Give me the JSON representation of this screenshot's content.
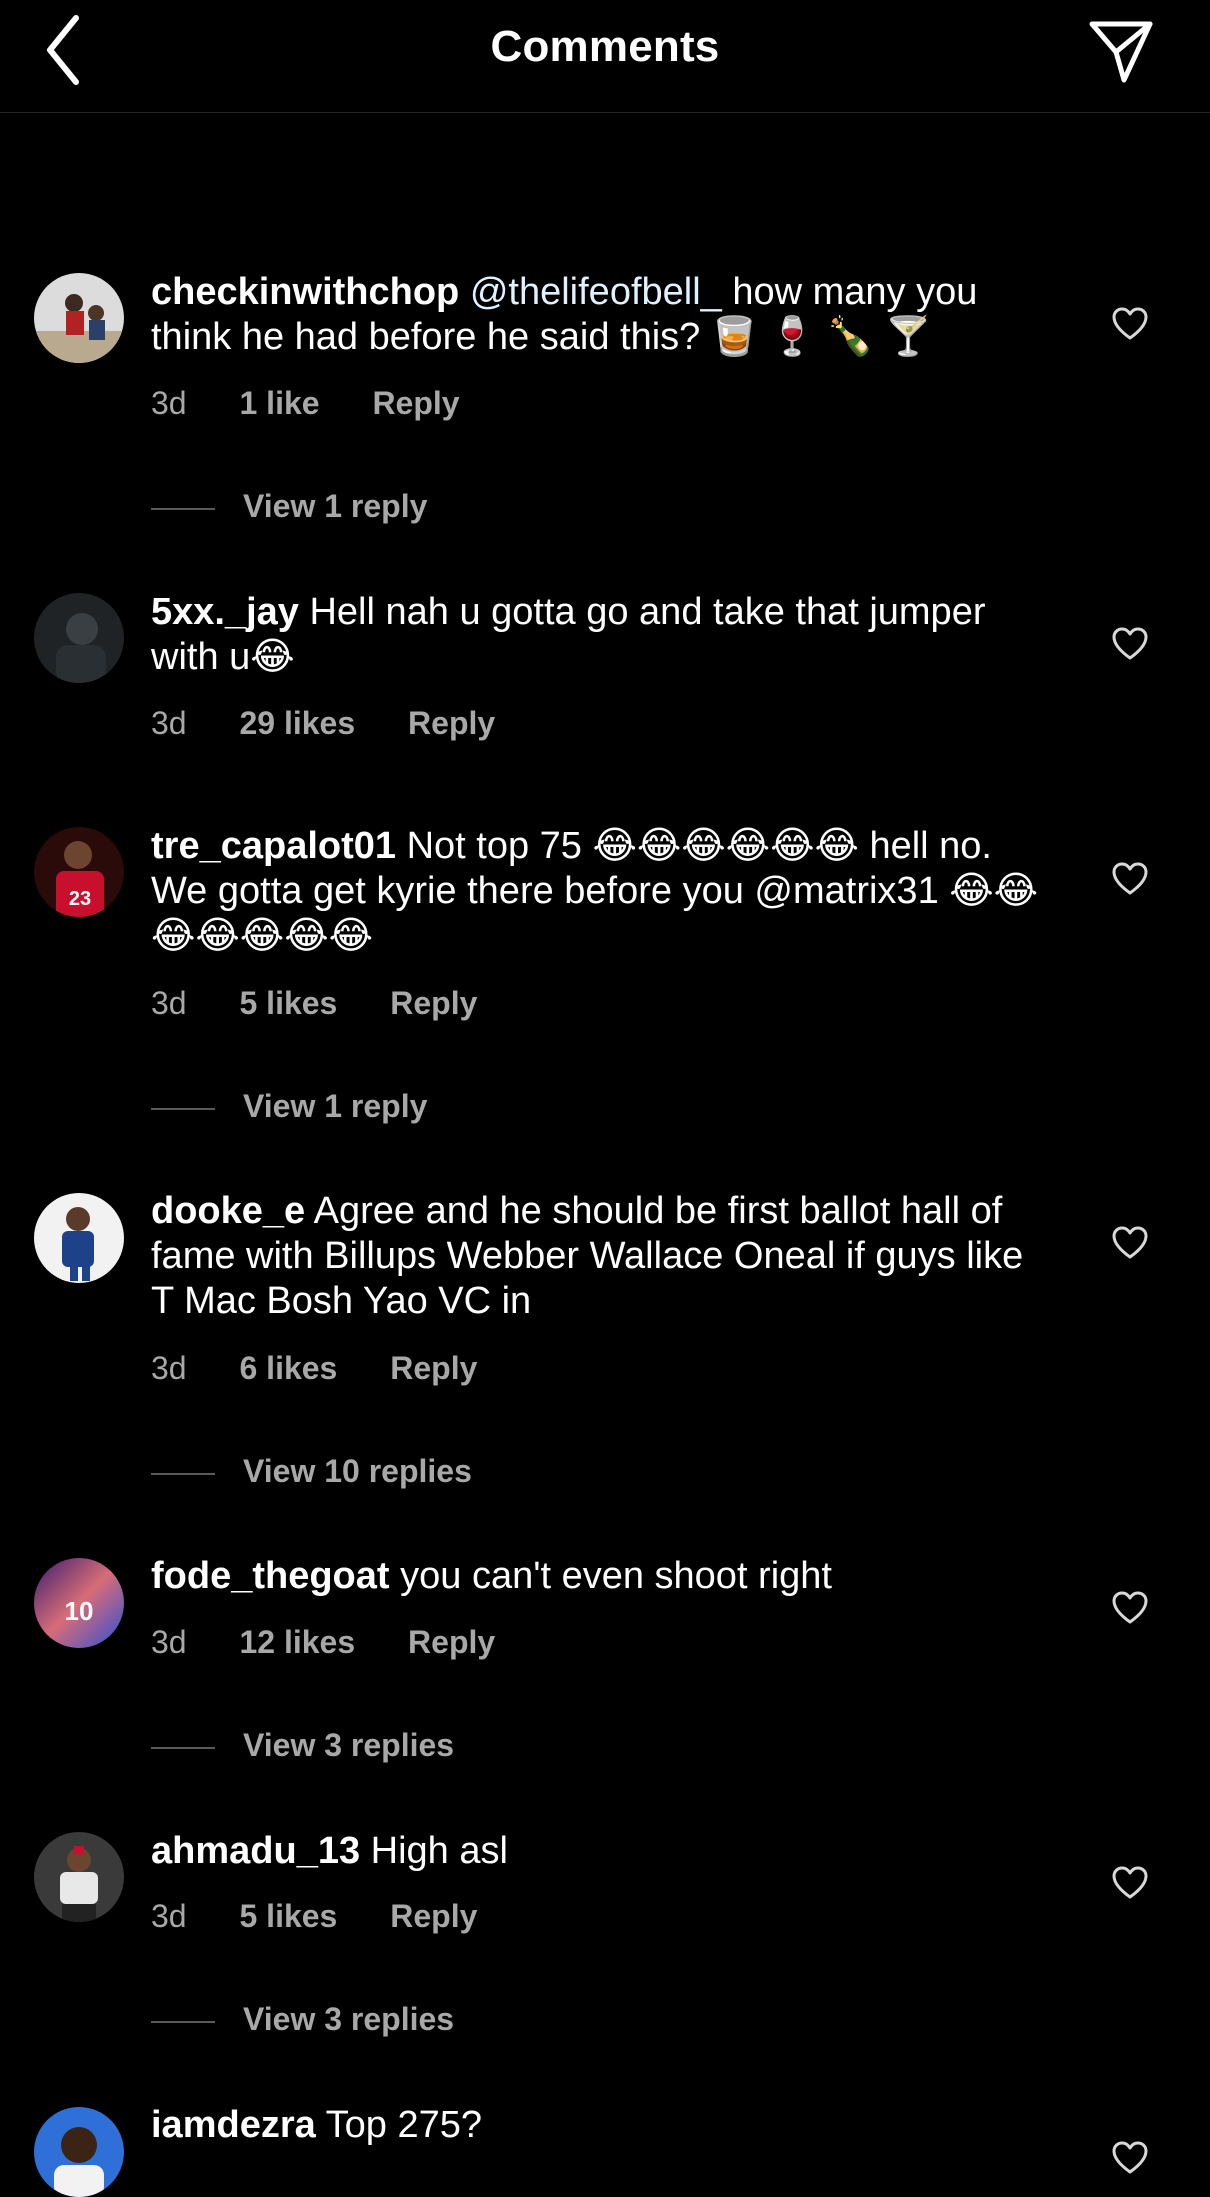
{
  "header": {
    "title": "Comments"
  },
  "comments": [
    {
      "username": "checkinwithchop",
      "mention": "@thelifeofbell_",
      "text": " how many you think he had before he said this? 🥃 🍷 🍾 🍸",
      "time": "3d",
      "likes": "1 like",
      "reply": "Reply",
      "view_replies": "View 1 reply"
    },
    {
      "username": "5xx._jay",
      "mention": "",
      "text": " Hell nah u gotta go and take that jumper with u😂",
      "time": "3d",
      "likes": "29 likes",
      "reply": "Reply",
      "view_replies": ""
    },
    {
      "username": "tre_capalot01",
      "mention": "",
      "text": " Not top 75 😂😂😂😂😂😂 hell no. We gotta get kyrie there before you @matrix31 😂😂😂😂😂😂😂",
      "time": "3d",
      "likes": "5 likes",
      "reply": "Reply",
      "view_replies": "View 1 reply"
    },
    {
      "username": "dooke_e",
      "mention": "",
      "text": " Agree and he should be first ballot hall of fame with Billups Webber Wallace Oneal if guys like T Mac Bosh Yao VC in",
      "time": "3d",
      "likes": "6 likes",
      "reply": "Reply",
      "view_replies": "View 10 replies"
    },
    {
      "username": "fode_thegoat",
      "mention": "",
      "text": " you can't even shoot right",
      "time": "3d",
      "likes": "12 likes",
      "reply": "Reply",
      "view_replies": "View 3 replies"
    },
    {
      "username": "ahmadu_13",
      "mention": "",
      "text": " High asl",
      "time": "3d",
      "likes": "5 likes",
      "reply": "Reply",
      "view_replies": "View 3 replies"
    },
    {
      "username": "iamdezra",
      "mention": "",
      "text": " Top 275?",
      "time": "",
      "likes": "",
      "reply": "",
      "view_replies": ""
    }
  ],
  "icons": {
    "back": "chevron-left-icon",
    "send": "paper-plane-icon",
    "like": "heart-outline-icon"
  },
  "colors": {
    "background": "#000000",
    "text": "#ffffff",
    "secondary_text": "#a8a8a8"
  }
}
